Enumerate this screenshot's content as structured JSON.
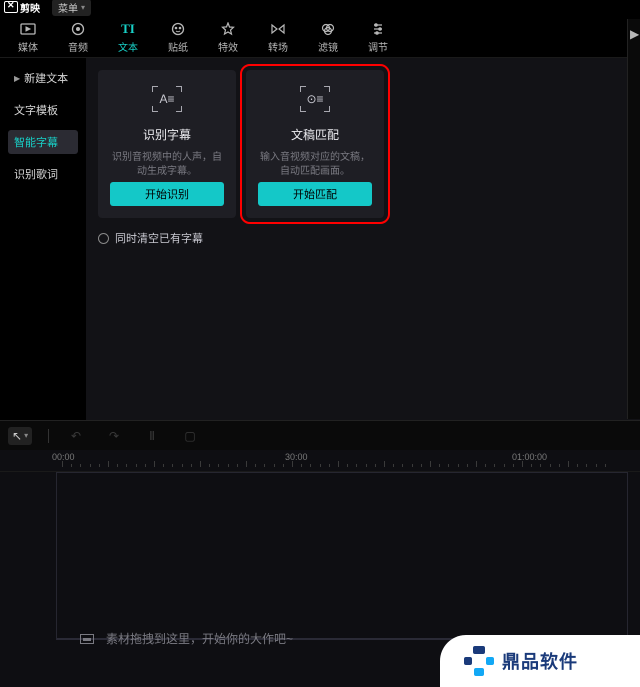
{
  "app": {
    "name": "剪映",
    "menu_label": "菜单"
  },
  "toolbar": [
    {
      "id": "media",
      "label": "媒体"
    },
    {
      "id": "audio",
      "label": "音频"
    },
    {
      "id": "text",
      "label": "文本",
      "active": true
    },
    {
      "id": "sticker",
      "label": "贴纸"
    },
    {
      "id": "effect",
      "label": "特效"
    },
    {
      "id": "transition",
      "label": "转场"
    },
    {
      "id": "filter",
      "label": "滤镜"
    },
    {
      "id": "adjust",
      "label": "调节"
    }
  ],
  "sidebar": [
    {
      "id": "new-text",
      "label": "新建文本",
      "has_arrow": true
    },
    {
      "id": "text-tmpl",
      "label": "文字模板"
    },
    {
      "id": "smart-sub",
      "label": "智能字幕",
      "active": true
    },
    {
      "id": "lyric",
      "label": "识别歌词"
    }
  ],
  "cards": [
    {
      "id": "recognize",
      "glyph": "A≡",
      "title": "识别字幕",
      "desc": "识别音视频中的人声，自动生成字幕。",
      "button": "开始识别"
    },
    {
      "id": "match",
      "glyph": "⊙≡",
      "title": "文稿匹配",
      "desc": "输入音视频对应的文稿，自动匹配画面。",
      "button": "开始匹配",
      "highlight": true
    }
  ],
  "checkbox": {
    "label": "同时清空已有字幕"
  },
  "timeline": {
    "ruler": [
      "00:00",
      "30:00",
      "01:00:00"
    ],
    "drop_hint": "素材拖拽到这里，开始你的大作吧~"
  },
  "badge": {
    "text": "鼎品软件"
  }
}
